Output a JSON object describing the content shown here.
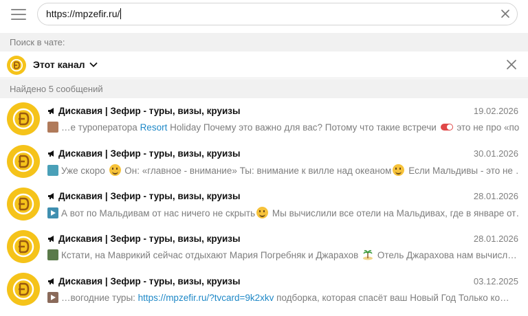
{
  "search": {
    "query": "https://mpzefir.ru/"
  },
  "section_search_in_chat": "Поиск в чате:",
  "filter": {
    "label": "Этот канал"
  },
  "found_label": "Найдено 5 сообщений",
  "results": [
    {
      "title": "Дискавия | Зефир - туры, визы, круизы",
      "date": "19.02.2026",
      "thumb_color": "#b07a5a",
      "snippet_a": "…е туроператора ",
      "snippet_hl": "Resort",
      "snippet_b": " Holiday  Почему это важно для вас? Потому что такие встречи ",
      "snippet_c": " это не про «по…"
    },
    {
      "title": "Дискавия | Зефир - туры, визы, круизы",
      "date": "30.01.2026",
      "thumb_color": "#4aa0b8",
      "snippet_a": "Уже скоро ",
      "snippet_b": " Он: «главное - внимание» Ты: внимание к вилле над океаном",
      "snippet_c": "  Если Мальдивы - это не …"
    },
    {
      "title": "Дискавия | Зефир - туры, визы, круизы",
      "date": "28.01.2026",
      "thumb_color": "#3f8fb0",
      "snippet_a": "А вот по Мальдивам от нас ничего не скрыть",
      "snippet_b": " Мы вычислили все отели на Мальдивах, где в январе от…"
    },
    {
      "title": "Дискавия | Зефир - туры, визы, круизы",
      "date": "28.01.2026",
      "thumb_color": "#5a7a4a",
      "snippet_a": "Кстати, на Маврикий сейчас отдыхают Мария Погребняк и Джарахов ",
      "snippet_b": "  Отель Джарахова нам вычисл…"
    },
    {
      "title": "Дискавия | Зефир - туры, визы, круизы",
      "date": "03.12.2025",
      "thumb_color": "#8a6a5a",
      "snippet_a": "…вогодние туры: ",
      "snippet_link_a": "https://",
      "snippet_link_b": "mpzefir.ru",
      "snippet_link_c": "/?tvcard=9k2xkv",
      "snippet_b": "  подборка, которая спасёт ваш Новый Год  Только ко…"
    }
  ],
  "colors": {
    "avatar_bg": "#f5c31a",
    "avatar_ring": "#e0a800",
    "link": "#1e88c7",
    "section_bg": "#f1f1f1",
    "muted_text": "#7d7d7d"
  },
  "icons": {
    "menu": "hamburger-icon",
    "clear": "close-icon",
    "dropdown": "chevron-down-icon",
    "channel": "megaphone-icon"
  }
}
